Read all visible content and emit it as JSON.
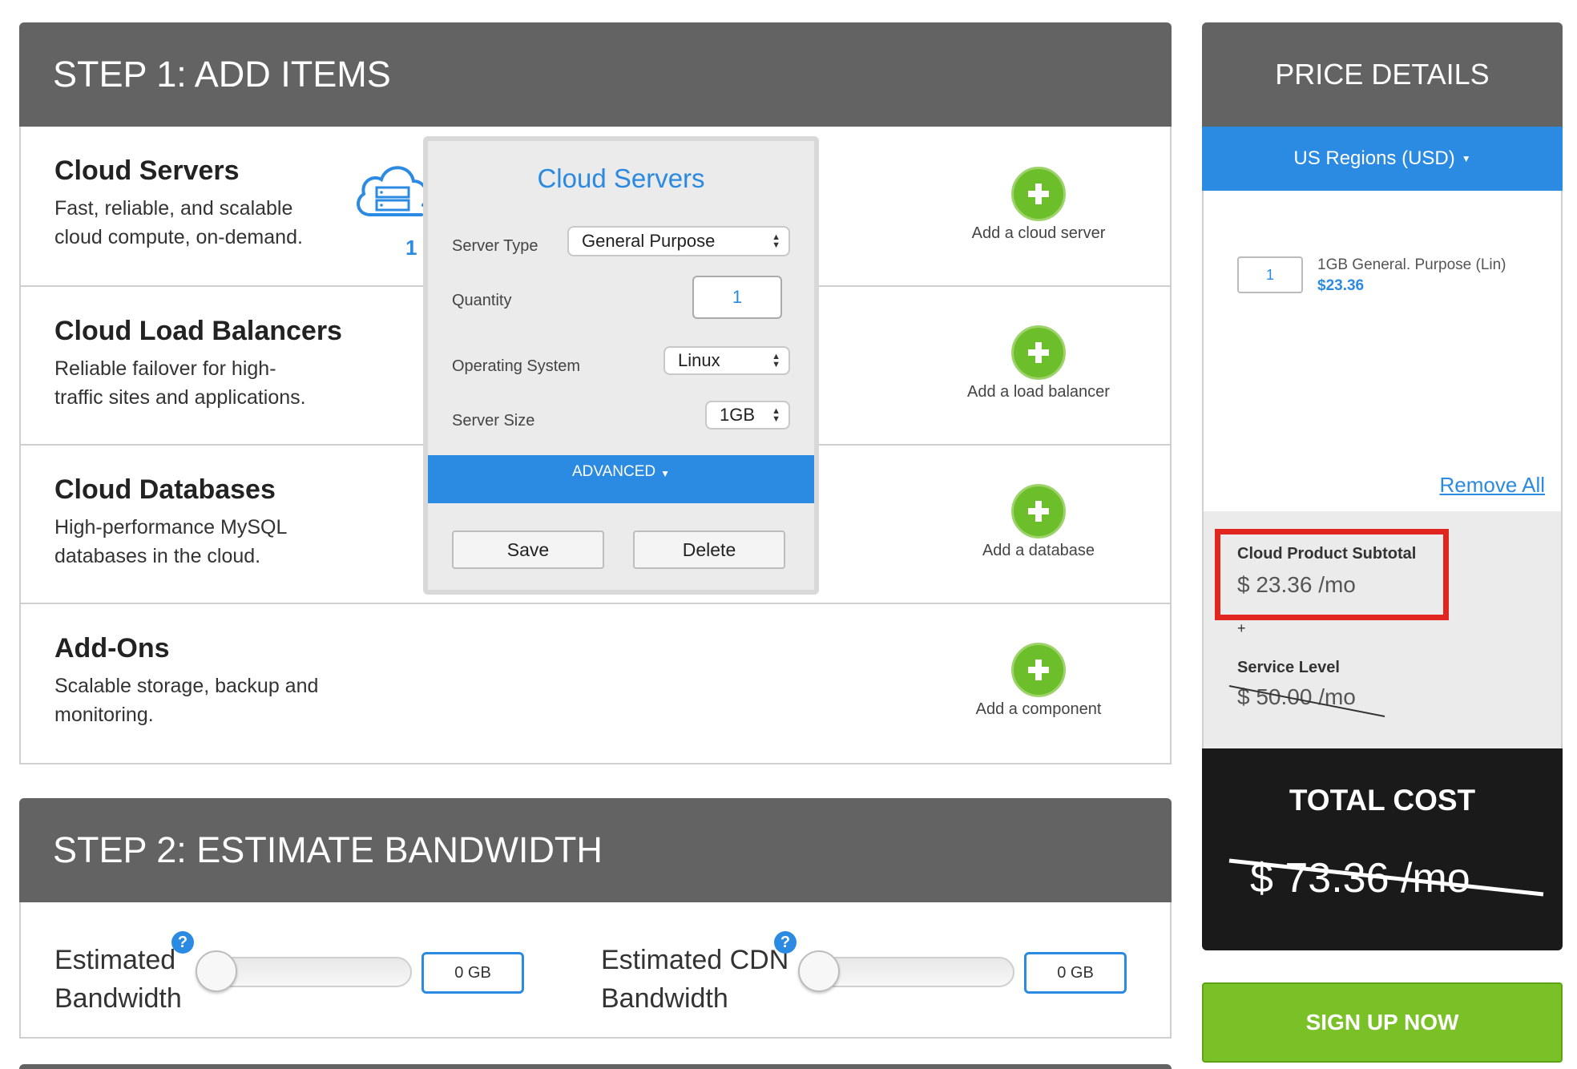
{
  "step1": {
    "title": "STEP 1: ADD ITEMS",
    "rows": [
      {
        "title": "Cloud Servers",
        "desc": "Fast, reliable, and scalable cloud compute, on-demand.",
        "add_label": "Add a cloud server",
        "count": "1"
      },
      {
        "title": "Cloud Load Balancers",
        "desc": "Reliable failover for high-traffic sites and applications.",
        "add_label": "Add a load balancer"
      },
      {
        "title": "Cloud Databases",
        "desc": "High-performance MySQL databases in the cloud.",
        "add_label": "Add a database"
      },
      {
        "title": "Add-Ons",
        "desc": "Scalable storage, backup and monitoring.",
        "add_label": "Add a component"
      }
    ]
  },
  "popup": {
    "title": "Cloud Servers",
    "server_type_label": "Server Type",
    "server_type_value": "General Purpose",
    "quantity_label": "Quantity",
    "quantity_value": "1",
    "os_label": "Operating System",
    "os_value": "Linux",
    "size_label": "Server Size",
    "size_value": "1GB",
    "advanced_label": "ADVANCED",
    "save_label": "Save",
    "delete_label": "Delete"
  },
  "step2": {
    "title": "STEP 2: ESTIMATE BANDWIDTH",
    "bandwidth_label_1": "Estimated",
    "bandwidth_label_2": "Bandwidth",
    "bandwidth_value": "0 GB",
    "cdn_label_1": "Estimated CDN",
    "cdn_label_2": "Bandwidth",
    "cdn_value": "0 GB",
    "help_glyph": "?",
    "bandwidth_slider_level": 0,
    "cdn_slider_level": 0
  },
  "price": {
    "title": "PRICE DETAILS",
    "region": "US Regions (USD)",
    "item_qty": "1",
    "item_name": "1GB General. Purpose (Lin)",
    "item_price": "$23.36",
    "remove_all": "Remove All",
    "subtotal_label": "Cloud Product Subtotal",
    "subtotal_value": "$ 23.36 /mo",
    "plus": "+",
    "service_label": "Service Level",
    "service_value": "$ 50.00 /mo",
    "total_label": "TOTAL COST",
    "total_value": "$ 73.36 /mo",
    "signup_label": "SIGN UP NOW"
  },
  "colors": {
    "header_grey": "#636363",
    "accent_blue": "#2b8ae2",
    "add_green": "#6cbf2a",
    "signup_green": "#79c127",
    "highlight_red": "#e0261e"
  },
  "icons": {
    "cloud_server": "cloud-server-icon",
    "add": "plus-icon",
    "dropdown": "caret-down-icon",
    "help": "question-icon"
  }
}
